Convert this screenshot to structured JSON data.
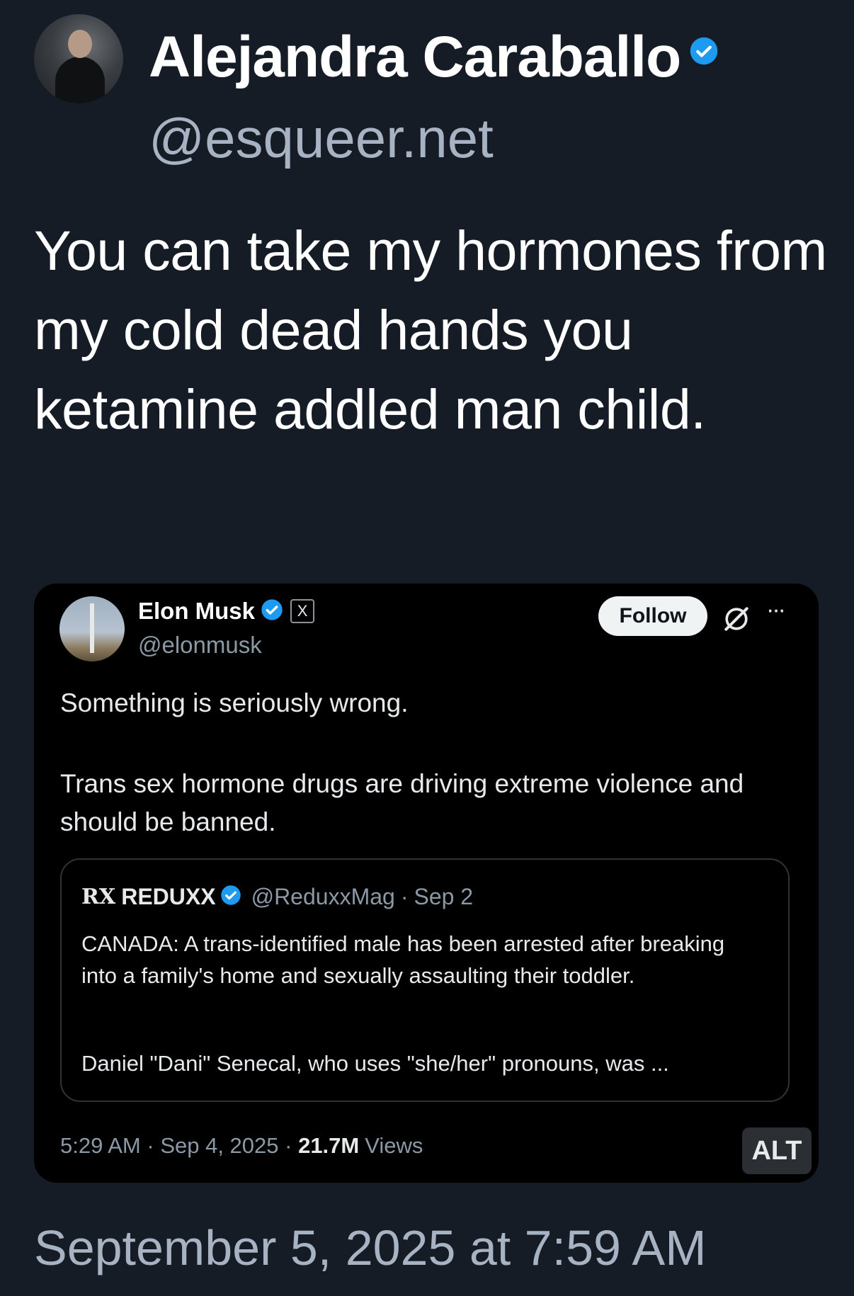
{
  "author": {
    "name": "Alejandra Caraballo",
    "handle": "@esqueer.net"
  },
  "post": {
    "text": "You can take my hormones from my cold dead hands you ketamine addled man child."
  },
  "quoted_post": {
    "name": "Elon Musk",
    "handle": "@elonmusk",
    "follow_label": "Follow",
    "x_label": "X",
    "more_label": "···",
    "text_line1": "Something is seriously wrong.",
    "text_line2": "Trans sex hormone drugs are driving extreme violence and should be banned.",
    "time": "5:29 AM",
    "date": "Sep 4, 2025",
    "views_count": "21.7M",
    "views_label": "Views",
    "alt_label": "ALT",
    "inner_quote": {
      "logo": "RX",
      "name": "REDUXX",
      "handle": "@ReduxxMag",
      "date": "Sep 2",
      "text1": "CANADA: A trans-identified male has been arrested after breaking into a family's home and sexually assaulting their toddler.",
      "text2": "Daniel \"Dani\" Senecal, who uses \"she/her\" pronouns, was ..."
    }
  },
  "timestamp": "September 5, 2025 at 7:59 AM",
  "colors": {
    "background": "#161c26",
    "verified": "#1d9bf0",
    "secondary_text": "#a7b3c2"
  }
}
